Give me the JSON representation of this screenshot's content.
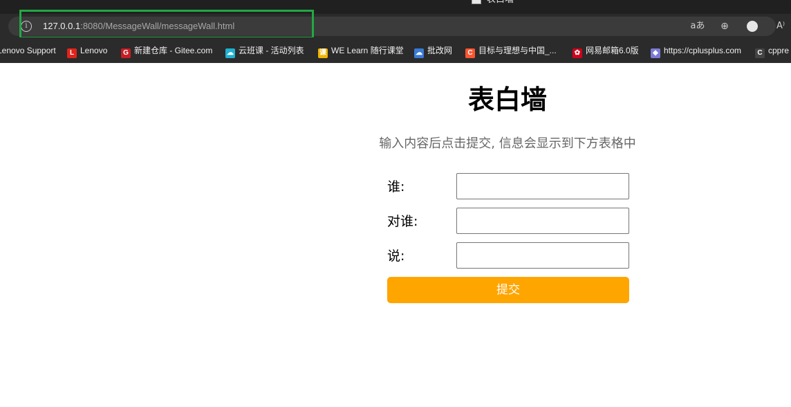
{
  "window": {
    "tab_title": "表白墙"
  },
  "address_bar": {
    "url_host": "127.0.0.1",
    "url_path": ":8080/MessageWall/messageWall.html",
    "info_icon": "info-icon",
    "highlight_color": "#22a844"
  },
  "toolbar_icons": [
    "read-mode-icon",
    "zoom-icon",
    "edge-copilot-icon",
    "read-aloud-icon"
  ],
  "toolbar_glyphs": {
    "read": "aあ",
    "zoom": "⊕",
    "aloud": "A⁾"
  },
  "bookmarks": [
    {
      "label": "Lenovo Support",
      "icon": "",
      "color": ""
    },
    {
      "label": "Lenovo",
      "icon": "L",
      "color": "#e2231a"
    },
    {
      "label": "新建仓库 - Gitee.com",
      "icon": "G",
      "color": "#c71d23"
    },
    {
      "label": "云班课 - 活动列表",
      "icon": "☁",
      "color": "#1fb2d1"
    },
    {
      "label": "WE Learn 随行课堂",
      "icon": "课",
      "color": "#f0b400"
    },
    {
      "label": "批改网",
      "icon": "☁",
      "color": "#3a7bd5"
    },
    {
      "label": "目标与理想与中国_...",
      "icon": "C",
      "color": "#fc5531"
    },
    {
      "label": "网易邮箱6.0版",
      "icon": "✿",
      "color": "#d0021b"
    },
    {
      "label": "https://cplusplus.com",
      "icon": "◆",
      "color": "#7b7bd6"
    },
    {
      "label": "cppre",
      "icon": "C",
      "color": "#444444"
    }
  ],
  "page": {
    "title": "表白墙",
    "subtitle": "输入内容后点击提交, 信息会显示到下方表格中",
    "form": {
      "from_label": "谁:",
      "from_value": "",
      "to_label": "对谁:",
      "to_value": "",
      "message_label": "说:",
      "message_value": "",
      "submit_label": "提交"
    }
  },
  "colors": {
    "accent": "#ffa500",
    "chrome": "#2b2b2b"
  }
}
